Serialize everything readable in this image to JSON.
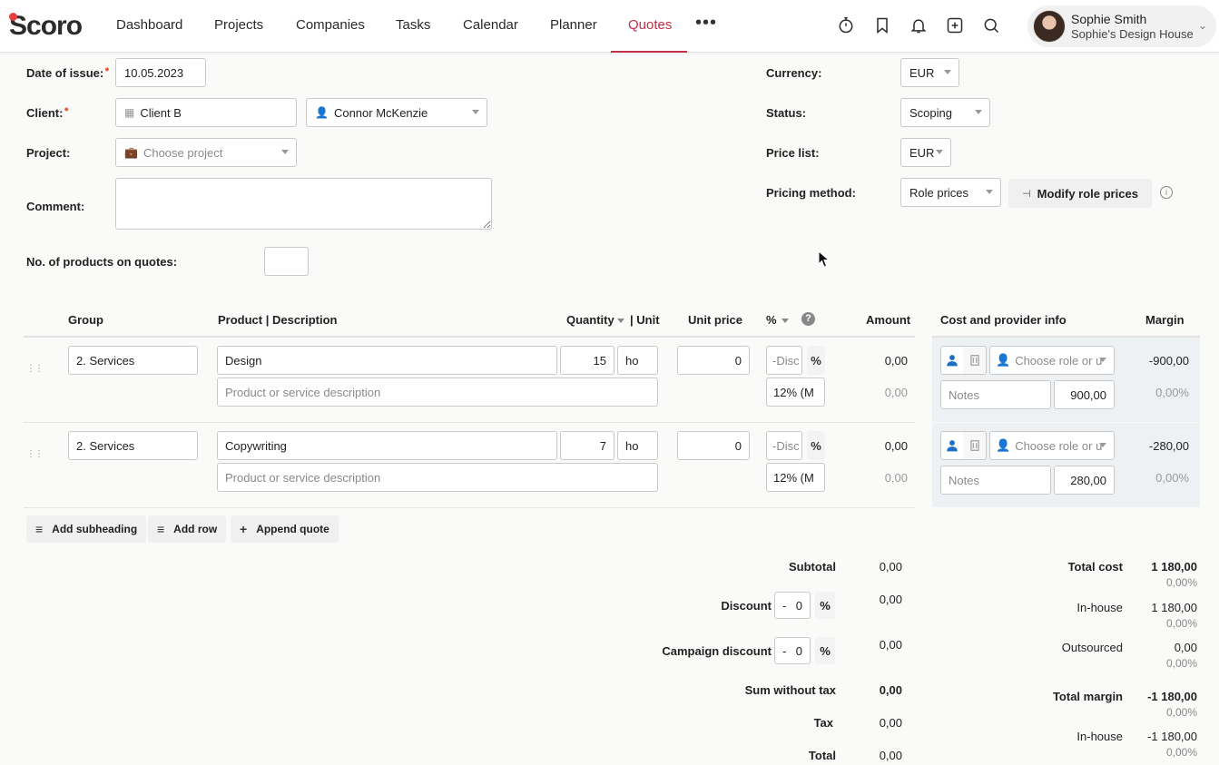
{
  "nav": {
    "logo": "Scoro",
    "items": [
      "Dashboard",
      "Projects",
      "Companies",
      "Tasks",
      "Calendar",
      "Planner",
      "Quotes"
    ],
    "active": "Quotes",
    "more": "•••",
    "icons": [
      "timer-icon",
      "bookmark-icon",
      "bell-icon",
      "add-icon",
      "search-icon"
    ],
    "user": {
      "name": "Sophie Smith",
      "company": "Sophie's Design House"
    }
  },
  "form": {
    "date_label": "Date of issue:",
    "date_value": "10.05.2023",
    "client_label": "Client:",
    "client_value": "Client B",
    "contact_value": "Connor McKenzie",
    "project_label": "Project:",
    "project_placeholder": "Choose project",
    "comment_label": "Comment:",
    "products_label": "No. of products on quotes:",
    "currency_label": "Currency:",
    "currency_value": "EUR",
    "status_label": "Status:",
    "status_value": "Scoping",
    "pricelist_label": "Price list:",
    "pricelist_value": "EUR",
    "pricing_label": "Pricing method:",
    "pricing_value": "Role prices",
    "modify_button": "Modify role prices"
  },
  "table": {
    "headers": {
      "group": "Group",
      "product": "Product | Description",
      "quantity": "Quantity",
      "unit": "| Unit",
      "unit_price": "Unit price",
      "percent": "%",
      "amount": "Amount",
      "cost_info": "Cost and provider info",
      "margin": "Margin"
    },
    "rows": [
      {
        "group": "2. Services",
        "product": "Design",
        "description_placeholder": "Product or service description",
        "quantity": "15",
        "unit": "ho",
        "unit_price": "0",
        "discount_placeholder": "-Disc",
        "percent_sign": "%",
        "vat": "12% (M",
        "amount": "0,00",
        "amount_tax": "0,00",
        "role_placeholder": "Choose role or u",
        "notes_placeholder": "Notes",
        "cost": "900,00",
        "margin": "-900,00",
        "margin_pct": "0,00%"
      },
      {
        "group": "2. Services",
        "product": "Copywriting",
        "description_placeholder": "Product or service description",
        "quantity": "7",
        "unit": "ho",
        "unit_price": "0",
        "discount_placeholder": "-Disc",
        "percent_sign": "%",
        "vat": "12% (M",
        "amount": "0,00",
        "amount_tax": "0,00",
        "role_placeholder": "Choose role or u",
        "notes_placeholder": "Notes",
        "cost": "280,00",
        "margin": "-280,00",
        "margin_pct": "0,00%"
      }
    ]
  },
  "actions": {
    "add_subheading": "Add subheading",
    "add_row": "Add row",
    "append_quote": "Append quote"
  },
  "totals": {
    "subtotal_label": "Subtotal",
    "subtotal": "0,00",
    "discount_label": "Discount",
    "discount_minus": "-",
    "discount_value": "0",
    "discount_pct": "%",
    "discount_amount": "0,00",
    "campaign_label": "Campaign discount",
    "campaign_minus": "-",
    "campaign_value": "0",
    "campaign_pct": "%",
    "campaign_amount": "0,00",
    "sum_wo_tax_label": "Sum without tax",
    "sum_wo_tax": "0,00",
    "tax_label": "Tax",
    "tax": "0,00",
    "total_label": "Total",
    "total": "0,00"
  },
  "cost_summary": {
    "total_cost_label": "Total cost",
    "total_cost": "1 180,00",
    "total_cost_pct": "0,00%",
    "inhouse_label": "In-house",
    "inhouse": "1 180,00",
    "inhouse_pct": "0,00%",
    "outsourced_label": "Outsourced",
    "outsourced": "0,00",
    "outsourced_pct": "0,00%",
    "total_margin_label": "Total margin",
    "total_margin": "-1 180,00",
    "total_margin_pct": "0,00%",
    "margin_inhouse_label": "In-house",
    "margin_inhouse": "-1 180,00",
    "margin_inhouse_pct": "0,00%"
  },
  "colors": {
    "accent": "#c3304a",
    "logo_dot": "#e8413d",
    "role_icon": "#1c6fc2",
    "panel": "#eef1f4"
  }
}
